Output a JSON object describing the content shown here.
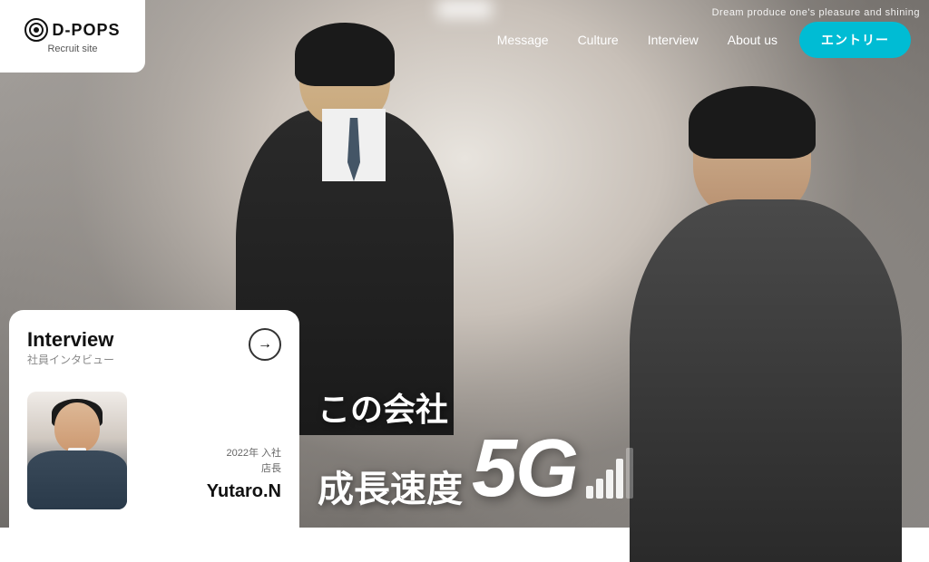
{
  "header": {
    "tagline": "Dream produce one's pleasure and shining",
    "logo": {
      "brand": "D-POPS",
      "subtitle": "Recruit site"
    },
    "nav": {
      "items": [
        "Message",
        "Culture",
        "Interview",
        "About us"
      ],
      "entry_button": "エントリー"
    }
  },
  "interview_card": {
    "title": "Interview",
    "subtitle": "社員インタビュー",
    "arrow": "→",
    "person": {
      "year": "2022年 入社",
      "role": "店長",
      "name": "Yutaro.N"
    }
  },
  "hero_text": {
    "line1": "この会社",
    "line2": "成長速度",
    "fiveg": "5G"
  },
  "colors": {
    "accent": "#00bcd4",
    "primary": "#111111",
    "white": "#ffffff"
  }
}
